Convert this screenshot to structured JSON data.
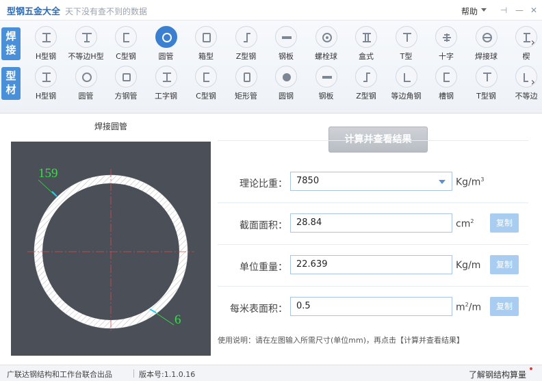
{
  "app": {
    "title": "型钢五金大全",
    "slogan": "天下没有查不到的数据",
    "help_label": "帮助",
    "pin_glyph": "⊣",
    "min_glyph": "—",
    "close_glyph": "✕"
  },
  "toolbar": {
    "row1_tag": "焊接",
    "row2_tag": "型材",
    "more_glyph": "›",
    "row1": [
      {
        "label": "H型钢",
        "icon": "h-beam-icon"
      },
      {
        "label": "不等边H型",
        "icon": "unequal-h-icon"
      },
      {
        "label": "C型钢",
        "icon": "c-channel-icon"
      },
      {
        "label": "圆管",
        "icon": "round-pipe-icon",
        "active": true
      },
      {
        "label": "箱型",
        "icon": "box-section-icon"
      },
      {
        "label": "Z型钢",
        "icon": "z-section-icon"
      },
      {
        "label": "钢板",
        "icon": "steel-plate-icon"
      },
      {
        "label": "螺栓球",
        "icon": "bolt-ball-icon"
      },
      {
        "label": "盒式",
        "icon": "box-type-icon"
      },
      {
        "label": "T型",
        "icon": "t-section-icon"
      },
      {
        "label": "十字",
        "icon": "cross-section-icon"
      },
      {
        "label": "焊接球",
        "icon": "welded-ball-icon"
      },
      {
        "label": "楔",
        "icon": "wedge-icon"
      }
    ],
    "row2": [
      {
        "label": "H型钢",
        "icon": "h-beam-icon"
      },
      {
        "label": "圆管",
        "icon": "round-pipe-icon"
      },
      {
        "label": "方钢管",
        "icon": "square-tube-icon"
      },
      {
        "label": "工字钢",
        "icon": "i-beam-icon"
      },
      {
        "label": "C型钢",
        "icon": "c-channel-icon"
      },
      {
        "label": "矩形管",
        "icon": "rect-tube-icon"
      },
      {
        "label": "圆钢",
        "icon": "round-bar-icon"
      },
      {
        "label": "钢板",
        "icon": "steel-plate-icon"
      },
      {
        "label": "Z型钢",
        "icon": "z-section-icon"
      },
      {
        "label": "等边角钢",
        "icon": "equal-angle-icon"
      },
      {
        "label": "槽钢",
        "icon": "channel-icon"
      },
      {
        "label": "T型钢",
        "icon": "t-section-icon"
      },
      {
        "label": "不等边",
        "icon": "unequal-angle-icon"
      }
    ]
  },
  "drawing": {
    "title": "焊接圆管",
    "outer_diameter": "159",
    "thickness": "6"
  },
  "form": {
    "calc_button": "计算并查看结果",
    "density_label": "理论比重：",
    "density_value": "7850",
    "density_unit": "Kg/m",
    "density_unit_exp": "3",
    "area_label": "截面面积：",
    "area_value": "28.84",
    "area_unit": "cm",
    "area_unit_exp": "2",
    "weight_label": "单位重量：",
    "weight_value": "22.639",
    "weight_unit": "Kg/m",
    "surface_label": "每米表面积：",
    "surface_value": "0.5",
    "surface_unit_pre": "m",
    "surface_unit_exp": "2",
    "surface_unit_post": "/m",
    "copy_label": "复制",
    "usage": "使用说明：请在左图输入所需尺寸(单位mm)，再点击【计算并查看结果】"
  },
  "status": {
    "credits": "广联达钢结构和工作台联合出品",
    "version": "版本号:1.1.0.16",
    "learn_more": "了解钢结构算量"
  },
  "colors": {
    "accent": "#3b7fd1",
    "tag_blue": "#4a90d9",
    "canvas_bg": "#4b4f58",
    "dimension_green": "#37e04a",
    "copy_button": "#a8cdf0"
  }
}
